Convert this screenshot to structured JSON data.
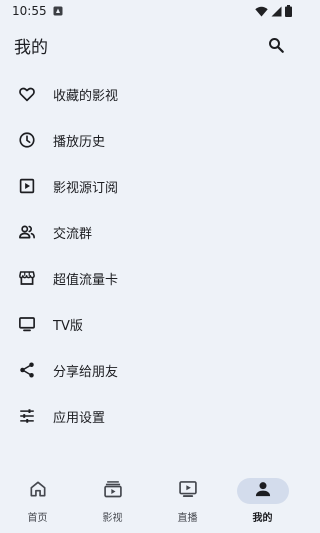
{
  "status_bar": {
    "time": "10:55",
    "icons": [
      "notification-icon",
      "wifi-icon",
      "signal-icon",
      "battery-icon"
    ]
  },
  "header": {
    "title": "我的",
    "search_icon": "search-icon"
  },
  "menu": {
    "items": [
      {
        "label": "收藏的影视",
        "icon": "heart-icon"
      },
      {
        "label": "播放历史",
        "icon": "clock-icon"
      },
      {
        "label": "影视源订阅",
        "icon": "play-box-icon"
      },
      {
        "label": "交流群",
        "icon": "group-icon"
      },
      {
        "label": "超值流量卡",
        "icon": "store-icon"
      },
      {
        "label": "TV版",
        "icon": "tv-icon"
      },
      {
        "label": "分享给朋友",
        "icon": "share-icon"
      },
      {
        "label": "应用设置",
        "icon": "tune-icon"
      }
    ]
  },
  "bottom_nav": {
    "items": [
      {
        "label": "首页",
        "icon": "home-icon",
        "active": false
      },
      {
        "label": "影视",
        "icon": "video-library-icon",
        "active": false
      },
      {
        "label": "直播",
        "icon": "live-tv-icon",
        "active": false
      },
      {
        "label": "我的",
        "icon": "person-icon",
        "active": true
      }
    ]
  },
  "colors": {
    "background": "#eef2f8",
    "active_pill": "#d3dcec",
    "text": "#1c1d21",
    "icon": "#1c1d21"
  }
}
